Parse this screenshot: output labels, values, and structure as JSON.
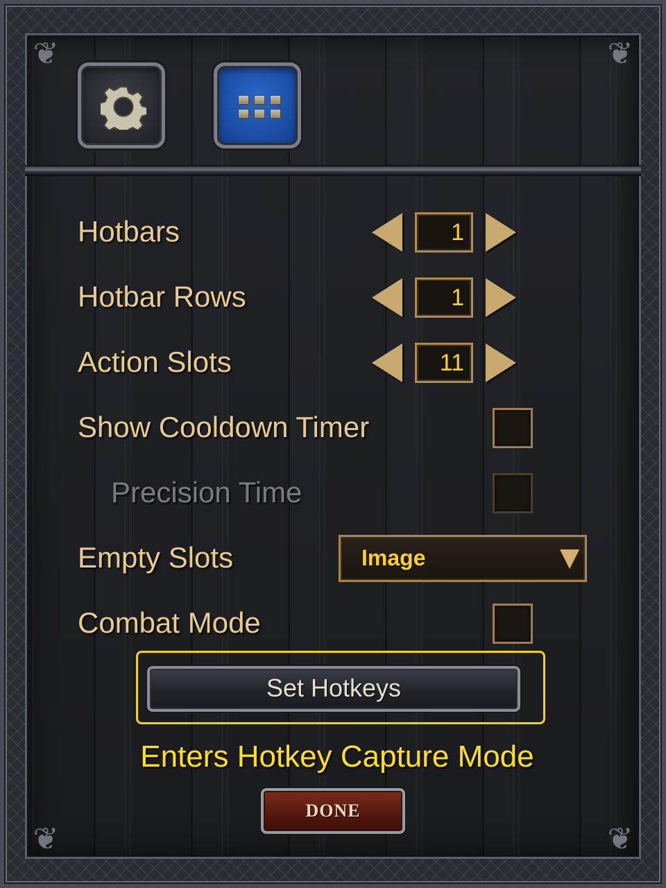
{
  "tabs": [
    {
      "icon": "gear-icon",
      "active": false
    },
    {
      "icon": "grid-icon",
      "active": true
    }
  ],
  "settings": {
    "hotbars": {
      "label": "Hotbars",
      "value": "1"
    },
    "hotbar_rows": {
      "label": "Hotbar Rows",
      "value": "1"
    },
    "action_slots": {
      "label": "Action Slots",
      "value": "11"
    },
    "show_cooldown_timer": {
      "label": "Show Cooldown Timer",
      "checked": false
    },
    "precision_time": {
      "label": "Precision Time",
      "checked": false,
      "enabled": false
    },
    "empty_slots": {
      "label": "Empty Slots",
      "value": "Image"
    },
    "combat_mode": {
      "label": "Combat Mode",
      "checked": false
    }
  },
  "set_hotkeys_label": "Set Hotkeys",
  "hint": "Enters Hotkey Capture Mode",
  "done_label": "DONE",
  "colors": {
    "label": "#e8cc8a",
    "value": "#ffd21a",
    "hint": "#ffe017",
    "highlight": "#f4d21c",
    "active_tab": "#1f55b5"
  }
}
